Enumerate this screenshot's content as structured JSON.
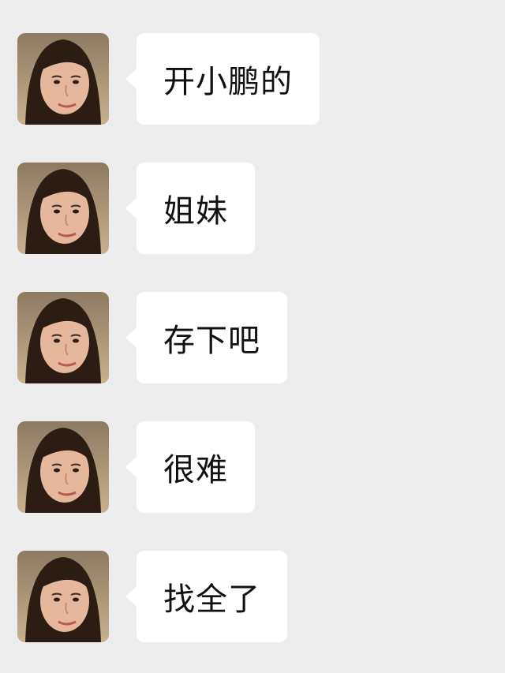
{
  "chat": {
    "messages": [
      {
        "text": "开小鹏的"
      },
      {
        "text": "姐妹"
      },
      {
        "text": "存下吧"
      },
      {
        "text": "很难"
      },
      {
        "text": "找全了"
      }
    ]
  },
  "icons": {
    "avatar": "avatar-portrait-icon"
  },
  "colors": {
    "background": "#ededed",
    "bubble": "#ffffff",
    "text": "#111111"
  }
}
